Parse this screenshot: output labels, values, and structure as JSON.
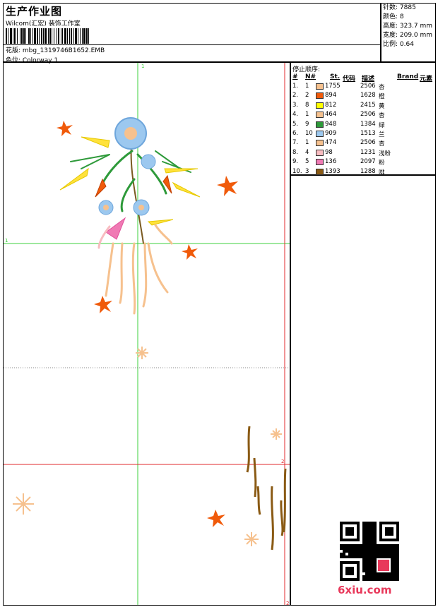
{
  "header": {
    "title": "生产作业图",
    "company": "Wilcom(汇宏) 装饰工作室",
    "design_label": "花版: mbg_1319746B1652.EMB",
    "colorway_label": "色位: Colorway 1"
  },
  "stats": [
    "针数: 7885",
    "颜色: 8",
    "高度: 323.7 mm",
    "宽度: 209.0 mm",
    "比例: 0.64"
  ],
  "legend": {
    "title": "停止顺序:",
    "headers": {
      "num": "#",
      "needle": "N#",
      "stitches": "St.",
      "code": "代码",
      "desc": "描述",
      "brand": "Brand",
      "element": "元素"
    },
    "rows": [
      {
        "num": "1.",
        "needle": "1",
        "color": "#f6c18e",
        "stitches": "1755",
        "code": "2506",
        "desc": "杏"
      },
      {
        "num": "2.",
        "needle": "2",
        "color": "#f05a0a",
        "stitches": "894",
        "code": "1628",
        "desc": "橙"
      },
      {
        "num": "3.",
        "needle": "8",
        "color": "#ffff00",
        "stitches": "812",
        "code": "2415",
        "desc": "黄"
      },
      {
        "num": "4.",
        "needle": "1",
        "color": "#f6c18e",
        "stitches": "464",
        "code": "2506",
        "desc": "杏"
      },
      {
        "num": "5.",
        "needle": "9",
        "color": "#2e9a3a",
        "stitches": "948",
        "code": "1384",
        "desc": "绿"
      },
      {
        "num": "6.",
        "needle": "10",
        "color": "#9cc8ef",
        "stitches": "909",
        "code": "1513",
        "desc": "兰"
      },
      {
        "num": "7.",
        "needle": "1",
        "color": "#f6c18e",
        "stitches": "474",
        "code": "2506",
        "desc": "杏"
      },
      {
        "num": "8.",
        "needle": "4",
        "color": "#f8bcc0",
        "stitches": "98",
        "code": "1231",
        "desc": "浅粉"
      },
      {
        "num": "9.",
        "needle": "5",
        "color": "#f07ab4",
        "stitches": "136",
        "code": "2097",
        "desc": "粉"
      },
      {
        "num": "10.",
        "needle": "3",
        "color": "#8a5a14",
        "stitches": "1393",
        "code": "1288",
        "desc": "啡"
      }
    ]
  },
  "guides": {
    "green_v_label": "1",
    "green_h_label": "1",
    "red_h_label": "2",
    "red_v_label": "2"
  },
  "watermark": "6xiu.com"
}
